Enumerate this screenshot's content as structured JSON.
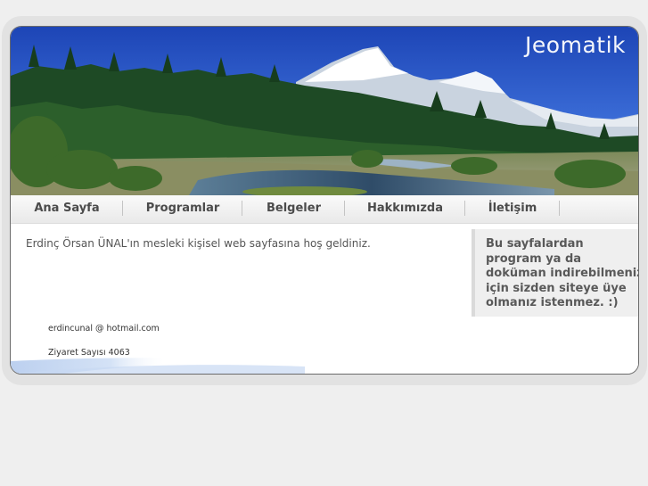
{
  "site": {
    "title": "Jeomatik"
  },
  "nav": {
    "items": [
      {
        "label": "Ana Sayfa"
      },
      {
        "label": "Programlar"
      },
      {
        "label": "Belgeler"
      },
      {
        "label": "Hakkımızda"
      },
      {
        "label": "İletişim"
      }
    ]
  },
  "main": {
    "welcome": "Erdinç Örsan ÜNAL'ın mesleki kişisel web sayfasına hoş geldiniz.",
    "email": "erdincunal @ hotmail.com",
    "visits": "Ziyaret Sayısı 4063"
  },
  "sidebar": {
    "text": "Bu sayfalardan\nprogram ya da\ndoküman indirebilmeniz\niçin sizden siteye üye\nolmanız istenmez. :)"
  },
  "colors": {
    "page_background": "#efefef",
    "sky": "#2a57c4",
    "forest": "#1f4a24",
    "nav_text": "#4b4b4b",
    "sidebar_background": "#efefef"
  }
}
